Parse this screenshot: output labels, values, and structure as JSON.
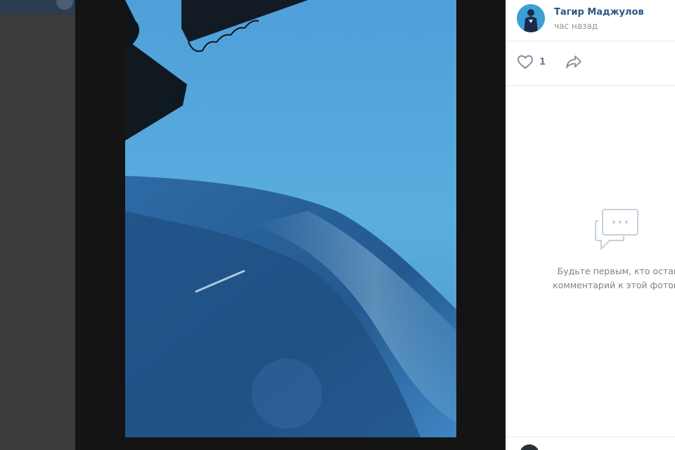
{
  "viewer": {
    "photo_icon": "storm-photo"
  },
  "post": {
    "author_name": "Тагир Маджулов",
    "time": "час назад",
    "avatar_icon": "user-avatar",
    "likes": "1",
    "like_icon": "heart-icon",
    "share_icon": "share-arrow-icon"
  },
  "comments": {
    "empty_icon": "chat-bubble-icon",
    "empty_text": "Будьте первым, кто остави\nкомментарий к этой фотогра"
  },
  "colors": {
    "accent": "#2a5885",
    "muted": "#939393",
    "icon": "#828a99"
  }
}
